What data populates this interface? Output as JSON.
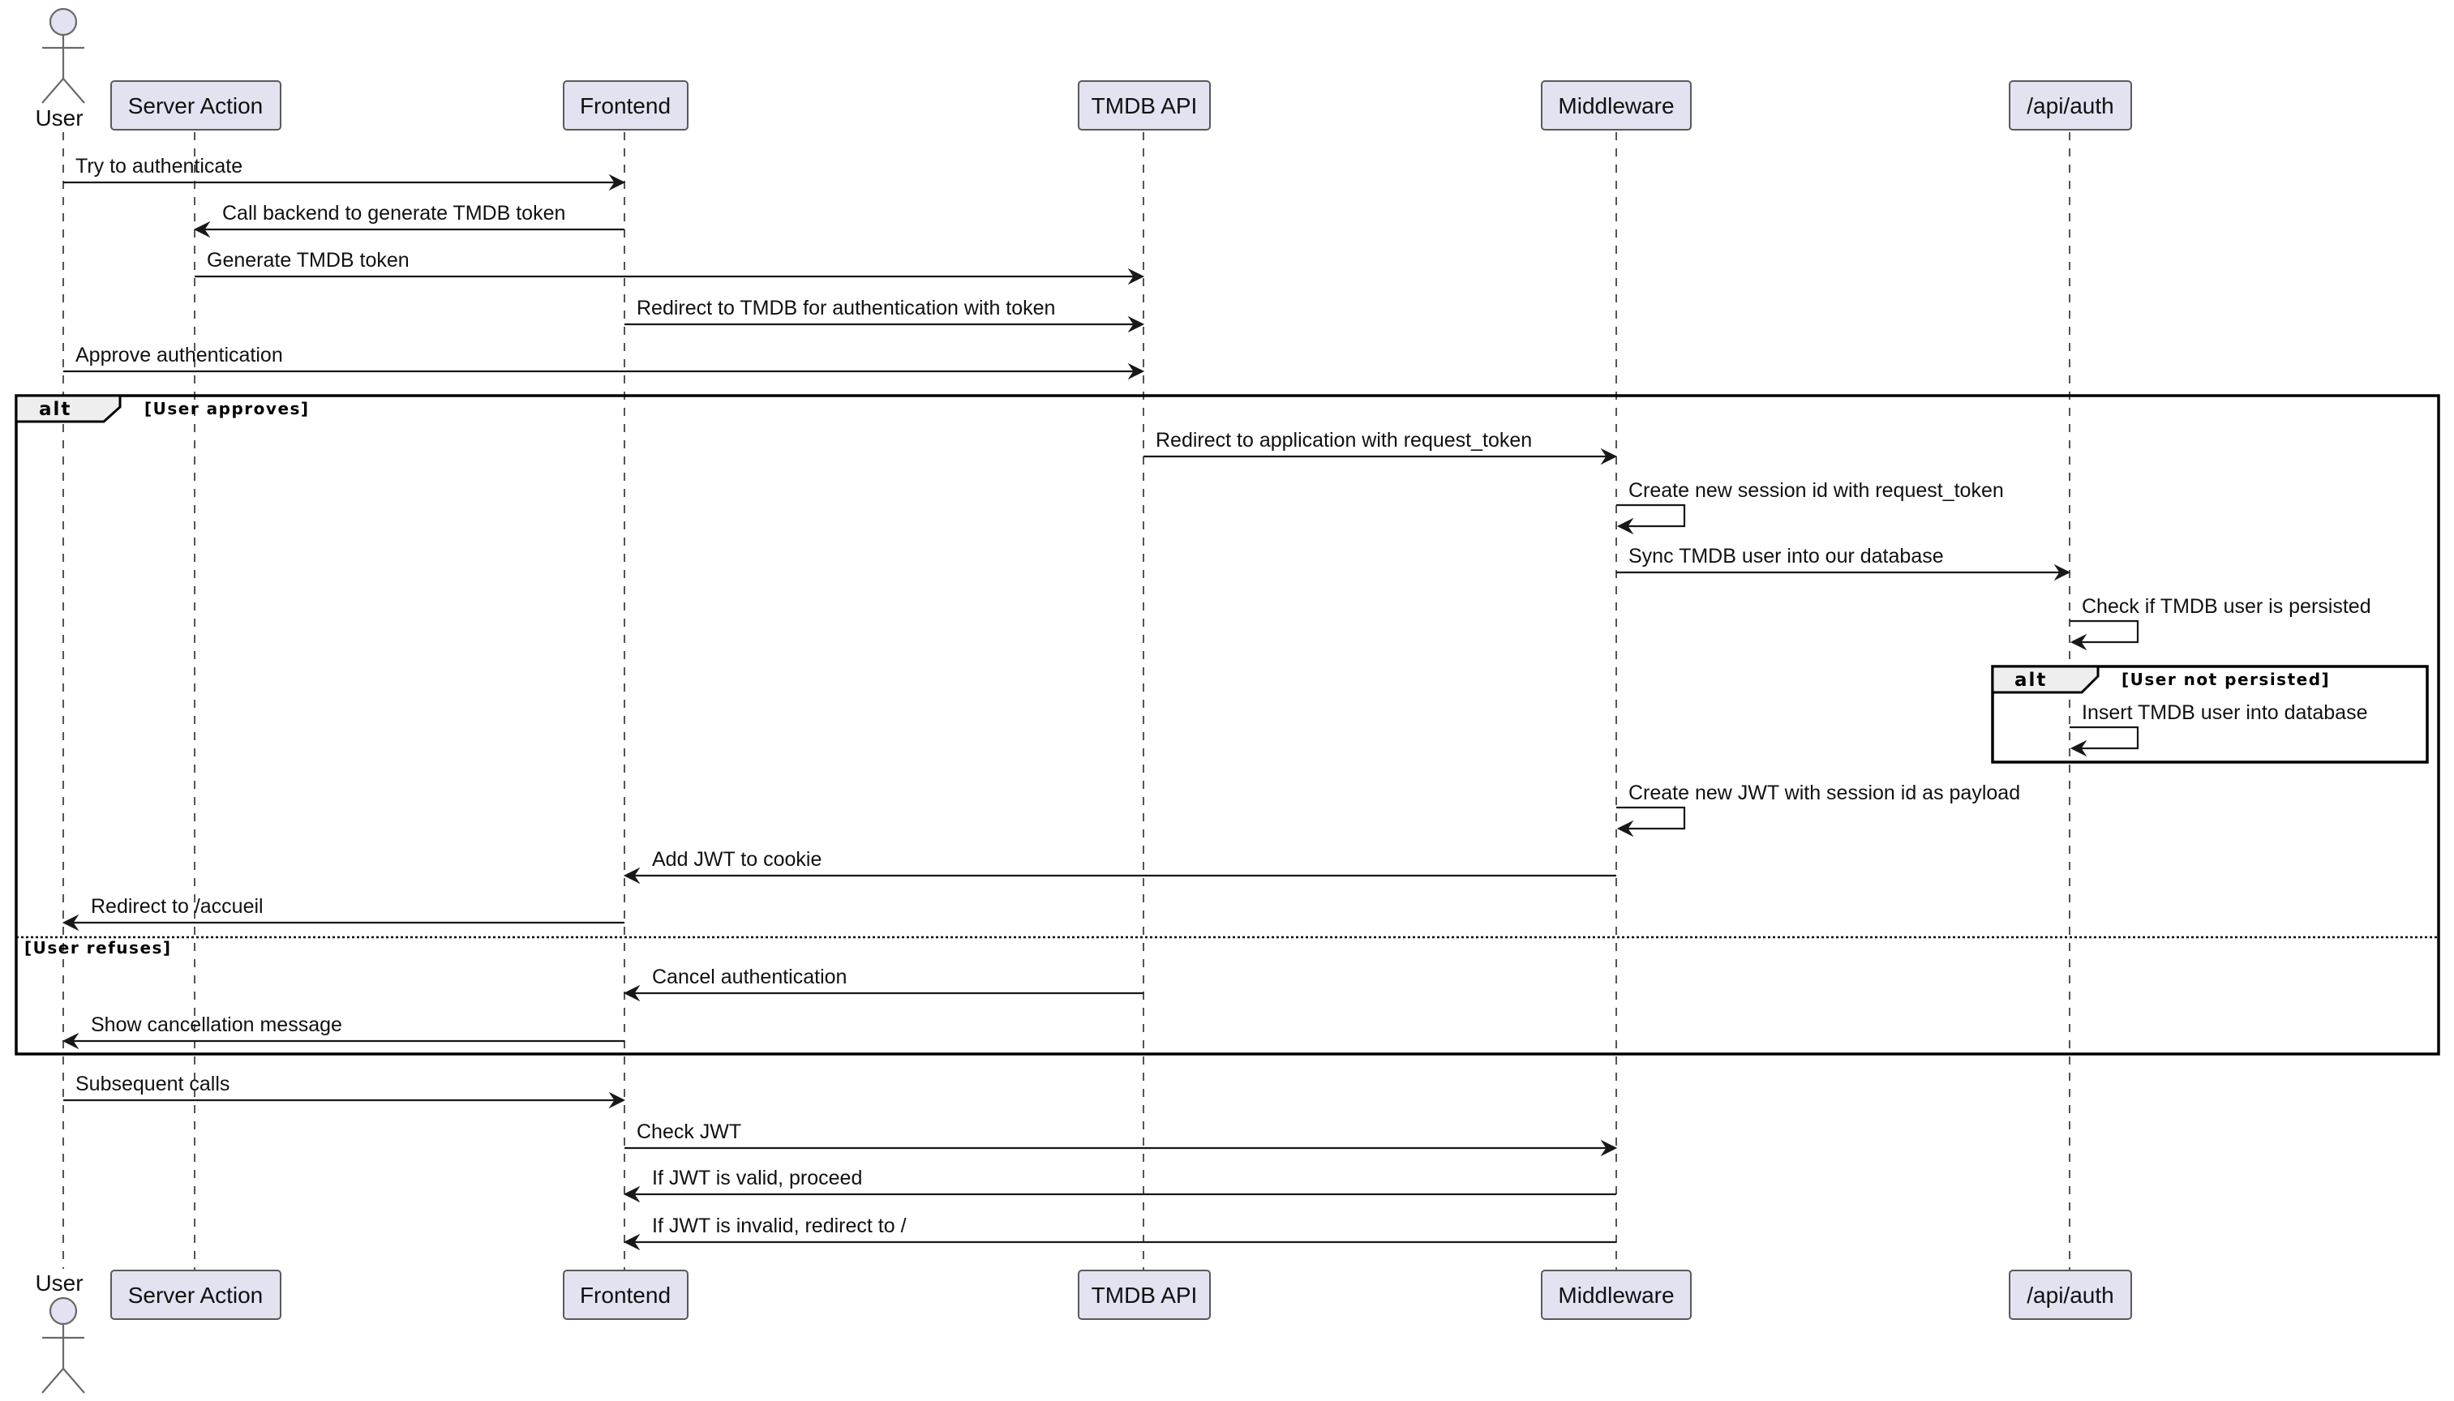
{
  "diagram": {
    "type": "sequence",
    "participants": [
      {
        "id": "user",
        "label": "User",
        "kind": "actor"
      },
      {
        "id": "server_action",
        "label": "Server Action",
        "kind": "participant"
      },
      {
        "id": "frontend",
        "label": "Frontend",
        "kind": "participant"
      },
      {
        "id": "tmdb_api",
        "label": "TMDB API",
        "kind": "participant"
      },
      {
        "id": "middleware",
        "label": "Middleware",
        "kind": "participant"
      },
      {
        "id": "api_auth",
        "label": "/api/auth",
        "kind": "participant"
      }
    ],
    "messages": [
      {
        "from": "user",
        "to": "frontend",
        "text": "Try to authenticate"
      },
      {
        "from": "frontend",
        "to": "server_action",
        "text": "Call backend to generate TMDB token"
      },
      {
        "from": "server_action",
        "to": "tmdb_api",
        "text": "Generate TMDB token"
      },
      {
        "from": "frontend",
        "to": "tmdb_api",
        "text": "Redirect to TMDB for authentication with token"
      },
      {
        "from": "user",
        "to": "tmdb_api",
        "text": "Approve authentication"
      },
      {
        "from": "tmdb_api",
        "to": "middleware",
        "text": "Redirect to application with request_token"
      },
      {
        "from": "middleware",
        "to": "middleware",
        "text": "Create new session id with request_token"
      },
      {
        "from": "middleware",
        "to": "api_auth",
        "text": "Sync TMDB user into our database"
      },
      {
        "from": "api_auth",
        "to": "api_auth",
        "text": "Check if TMDB user is persisted"
      },
      {
        "from": "api_auth",
        "to": "api_auth",
        "text": "Insert TMDB user into database"
      },
      {
        "from": "middleware",
        "to": "middleware",
        "text": "Create new JWT with session id as payload"
      },
      {
        "from": "middleware",
        "to": "frontend",
        "text": "Add JWT to cookie"
      },
      {
        "from": "frontend",
        "to": "user",
        "text": "Redirect to /accueil"
      },
      {
        "from": "tmdb_api",
        "to": "frontend",
        "text": "Cancel authentication"
      },
      {
        "from": "frontend",
        "to": "user",
        "text": "Show cancellation message"
      },
      {
        "from": "user",
        "to": "frontend",
        "text": "Subsequent calls"
      },
      {
        "from": "frontend",
        "to": "middleware",
        "text": "Check JWT"
      },
      {
        "from": "middleware",
        "to": "frontend",
        "text": "If JWT is valid, proceed"
      },
      {
        "from": "middleware",
        "to": "frontend",
        "text": "If JWT is invalid, redirect to /"
      }
    ],
    "fragments": [
      {
        "operator": "alt",
        "guard": "[User approves]",
        "else_guard": "[User refuses]"
      },
      {
        "operator": "alt",
        "guard": "[User not persisted]"
      }
    ]
  }
}
